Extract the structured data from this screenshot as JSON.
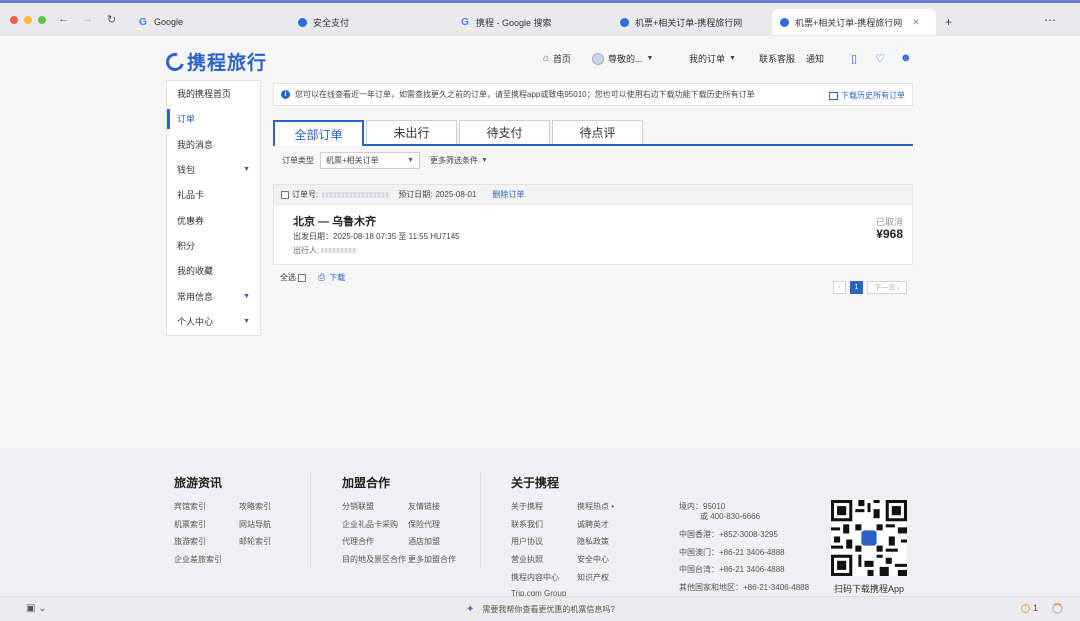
{
  "browser": {
    "tabs": [
      {
        "label": "Google",
        "icon": "google-icon"
      },
      {
        "label": "安全支付",
        "icon": "ctrip-icon"
      },
      {
        "label": "携程 - Google 搜索",
        "icon": "google-icon"
      },
      {
        "label": "机票+相关订单-携程旅行网",
        "icon": "ctrip-icon"
      },
      {
        "label": "机票+相关订单-携程旅行网",
        "icon": "ctrip-icon"
      }
    ]
  },
  "header": {
    "logo_text": "携程旅行",
    "nav": {
      "home": "首页",
      "user": "尊敬的...",
      "my_orders": "我的订单",
      "service": "联系客服",
      "notify": "通知"
    }
  },
  "sidebar": {
    "items": [
      {
        "label": "我的携程首页",
        "active": false,
        "expand": false
      },
      {
        "label": "订单",
        "active": true,
        "expand": false
      },
      {
        "label": "我的消息",
        "active": false,
        "expand": false
      },
      {
        "label": "钱包",
        "active": false,
        "expand": true
      },
      {
        "label": "礼品卡",
        "active": false,
        "expand": false
      },
      {
        "label": "优惠券",
        "active": false,
        "expand": false
      },
      {
        "label": "积分",
        "active": false,
        "expand": false
      },
      {
        "label": "我的收藏",
        "active": false,
        "expand": false
      },
      {
        "label": "常用信息",
        "active": false,
        "expand": true
      },
      {
        "label": "个人中心",
        "active": false,
        "expand": true
      }
    ]
  },
  "notice": {
    "text": "您可以在线查看近一年订单，如需查找更久之前的订单，请至携程app或致电95010；您也可以使用右边下载功能下载历史所有订单",
    "link": "下载历史所有订单"
  },
  "order_tabs": [
    "全部订单",
    "未出行",
    "待支付",
    "待点评"
  ],
  "filters": {
    "type_label": "订单类型",
    "type_value": "机票+相关订单",
    "more": "更多筛选条件"
  },
  "order": {
    "number_label": "订单号:",
    "booking_date_label": "预订日期:",
    "booking_date": "2025-08-01",
    "delete": "删除订单",
    "route": "北京 — 乌鲁木齐",
    "departure": "出发日期：2025-08-18 07:35 至 11:55 HU7145",
    "traveler_label": "出行人:",
    "status": "已取消",
    "price": "¥968"
  },
  "list_actions": {
    "select_all": "全选",
    "download": "下载"
  },
  "pagination": {
    "prev": "‹",
    "current": "1",
    "next": "下一页 ›"
  },
  "footer": {
    "col1": {
      "title": "旅游资讯",
      "links": [
        "宾馆索引",
        "攻略索引",
        "机票索引",
        "网站导航",
        "旅游索引",
        "邮轮索引",
        "企业差旅索引"
      ]
    },
    "col2": {
      "title": "加盟合作",
      "links": [
        "分销联盟",
        "友情链接",
        "企业礼品卡采购",
        "保险代理",
        "代理合作",
        "酒店加盟",
        "目的地及景区合作",
        "更多加盟合作"
      ]
    },
    "col3": {
      "title": "关于携程",
      "links": [
        "关于携程",
        "携程热点 •",
        "联系我们",
        "诚聘英才",
        "用户协议",
        "隐私政策",
        "营业执照",
        "安全中心",
        "携程内容中心",
        "知识产权",
        "Trip.com Group"
      ]
    },
    "contact": [
      "境内：95010",
      "或 400-830-6666",
      "中国香港：+852-3008-3295",
      "中国澳门：+86-21 3406-4888",
      "中国台湾：+86-21 3406-4888",
      "其他国家和地区：+86-21-3406-4888"
    ],
    "qr_caption": "扫码下载携程App"
  },
  "bottom_bar": {
    "prompt": "需要我帮你查看更优惠的机票信息吗?",
    "warn_count": "1"
  }
}
